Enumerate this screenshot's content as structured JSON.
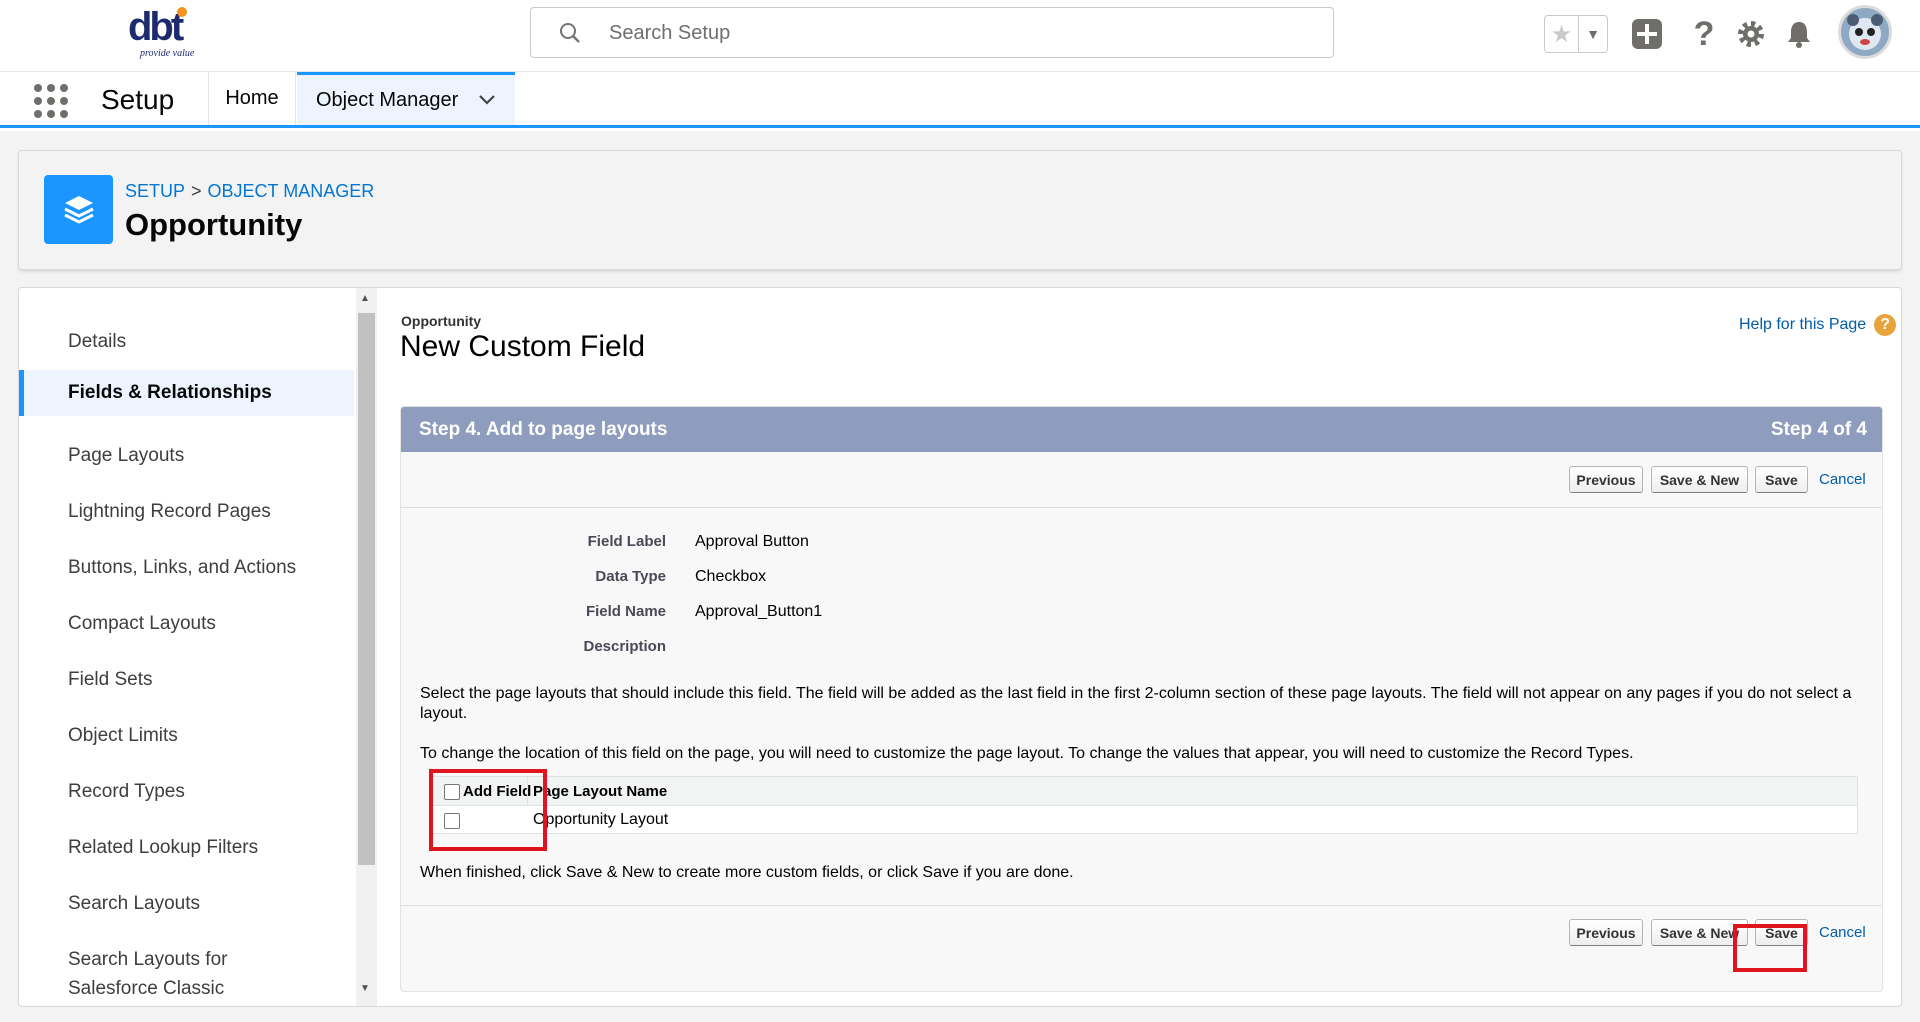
{
  "header": {
    "logo_text": "dbt",
    "logo_tagline": "provide value",
    "search_placeholder": "Search Setup"
  },
  "nav": {
    "app_name": "Setup",
    "tabs": [
      {
        "label": "Home"
      },
      {
        "label": "Object Manager"
      }
    ]
  },
  "page_header": {
    "breadcrumb": [
      "SETUP",
      "OBJECT MANAGER"
    ],
    "breadcrumb_sep": ">",
    "title": "Opportunity"
  },
  "sidebar": {
    "items": [
      {
        "label": "Details"
      },
      {
        "label": "Fields & Relationships",
        "active": true
      },
      {
        "label": "Page Layouts"
      },
      {
        "label": "Lightning Record Pages"
      },
      {
        "label": "Buttons, Links, and Actions"
      },
      {
        "label": "Compact Layouts"
      },
      {
        "label": "Field Sets"
      },
      {
        "label": "Object Limits"
      },
      {
        "label": "Record Types"
      },
      {
        "label": "Related Lookup Filters"
      },
      {
        "label": "Search Layouts"
      },
      {
        "label": "Search Layouts for Salesforce Classic"
      }
    ]
  },
  "content": {
    "object_label": "Opportunity",
    "title": "New Custom Field",
    "help_link": "Help for this Page",
    "step_title": "Step 4. Add to page layouts",
    "step_count": "Step 4 of 4",
    "buttons": {
      "previous": "Previous",
      "save_new": "Save & New",
      "save": "Save",
      "cancel": "Cancel"
    },
    "fields": [
      {
        "label": "Field Label",
        "value": "Approval Button"
      },
      {
        "label": "Data Type",
        "value": "Checkbox"
      },
      {
        "label": "Field Name",
        "value": "Approval_Button1"
      },
      {
        "label": "Description",
        "value": ""
      }
    ],
    "instructions_1": "Select the page layouts that should include this field. The field will be added as the last field in the first 2-column section of these page layouts. The field will not appear on any pages if you do not select a layout.",
    "instructions_2": "To change the location of this field on the page, you will need to customize the page layout. To change the values that appear, you will need to customize the Record Types.",
    "layout_table": {
      "col_add": "Add Field",
      "col_name": "Page Layout Name",
      "rows": [
        {
          "name": "Opportunity Layout",
          "checked": false
        }
      ]
    },
    "finish_note": "When finished, click Save & New to create more custom fields, or click Save if you are done."
  },
  "colors": {
    "accent": "#1b96ff",
    "step_header": "#8e9dbe",
    "highlight": "#e0141e",
    "link": "#015ba7"
  }
}
